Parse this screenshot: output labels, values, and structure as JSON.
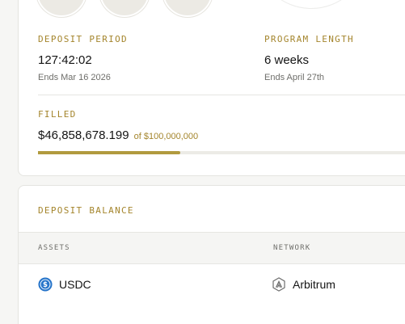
{
  "colors": {
    "accent": "#a4852c",
    "progress": "#b19a3e",
    "usdc": "#2775ca"
  },
  "program": {
    "deposit_period": {
      "label": "DEPOSIT PERIOD",
      "value": "127:42:02",
      "sub": "Ends Mar 16 2026"
    },
    "program_length": {
      "label": "PROGRAM LENGTH",
      "value": "6 weeks",
      "sub": "Ends April 27th"
    },
    "filled": {
      "label": "FILLED",
      "amount": "$46,858,678.199",
      "of": "of $100,000,000",
      "fraction": 0.4686
    }
  },
  "deposit_balance": {
    "title": "DEPOSIT BALANCE",
    "columns": [
      "ASSETS",
      "NETWORK"
    ],
    "rows": [
      {
        "asset": "USDC",
        "asset_icon": "usdc-icon",
        "network": "Arbitrum",
        "network_icon": "arbitrum-icon"
      }
    ]
  }
}
